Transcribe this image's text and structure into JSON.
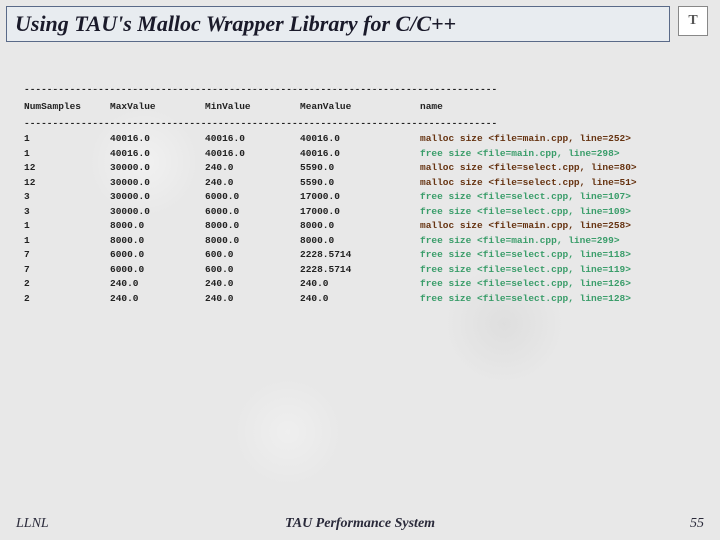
{
  "title": "Using TAU's Malloc Wrapper Library for C/C++",
  "logo_letter": "T",
  "dash_line": "-----------------------------------------------------------------------------------",
  "columns": {
    "num": "NumSamples",
    "max": "MaxValue",
    "min": "MinValue",
    "mean": "MeanValue",
    "name": "name"
  },
  "rows": [
    {
      "num": "1",
      "max": "40016.0",
      "min": "40016.0",
      "mean": "40016.0",
      "op": "malloc",
      "file": "main.cpp",
      "line": "252"
    },
    {
      "num": "1",
      "max": "40016.0",
      "min": "40016.0",
      "mean": "40016.0",
      "op": "free",
      "file": "main.cpp",
      "line": "298"
    },
    {
      "num": "12",
      "max": "30000.0",
      "min": "240.0",
      "mean": "5590.0",
      "op": "malloc",
      "file": "select.cpp",
      "line": "80"
    },
    {
      "num": "12",
      "max": "30000.0",
      "min": "240.0",
      "mean": "5590.0",
      "op": "malloc",
      "file": "select.cpp",
      "line": "51"
    },
    {
      "num": "3",
      "max": "30000.0",
      "min": "6000.0",
      "mean": "17000.0",
      "op": "free",
      "file": "select.cpp",
      "line": "107"
    },
    {
      "num": "3",
      "max": "30000.0",
      "min": "6000.0",
      "mean": "17000.0",
      "op": "free",
      "file": "select.cpp",
      "line": "109"
    },
    {
      "num": "1",
      "max": "8000.0",
      "min": "8000.0",
      "mean": "8000.0",
      "op": "malloc",
      "file": "main.cpp",
      "line": "258"
    },
    {
      "num": "1",
      "max": "8000.0",
      "min": "8000.0",
      "mean": "8000.0",
      "op": "free",
      "file": "main.cpp",
      "line": "299"
    },
    {
      "num": "7",
      "max": "6000.0",
      "min": "600.0",
      "mean": "2228.5714",
      "op": "free",
      "file": "select.cpp",
      "line": "118"
    },
    {
      "num": "7",
      "max": "6000.0",
      "min": "600.0",
      "mean": "2228.5714",
      "op": "free",
      "file": "select.cpp",
      "line": "119"
    },
    {
      "num": "2",
      "max": "240.0",
      "min": "240.0",
      "mean": "240.0",
      "op": "free",
      "file": "select.cpp",
      "line": "126"
    },
    {
      "num": "2",
      "max": "240.0",
      "min": "240.0",
      "mean": "240.0",
      "op": "free",
      "file": "select.cpp",
      "line": "128"
    }
  ],
  "footer": {
    "left": "LLNL",
    "center": "TAU Performance System",
    "right": "55"
  }
}
